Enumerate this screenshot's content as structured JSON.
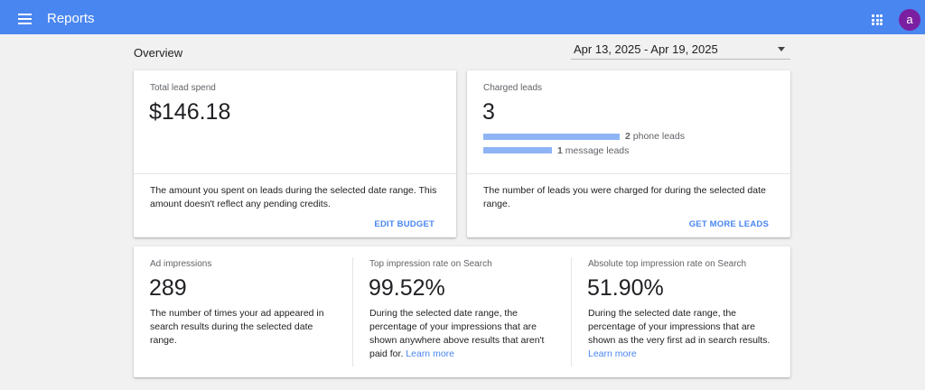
{
  "header": {
    "title": "Reports",
    "avatar_letter": "a",
    "menu_icon": "hamburger-menu-icon",
    "apps_icon": "apps-grid-icon",
    "brand_color": "#4a86f0",
    "avatar_color": "#7b1fa2"
  },
  "page": {
    "title": "Overview",
    "date_range": "Apr 13, 2025 - Apr 19, 2025"
  },
  "spend_card": {
    "label": "Total lead spend",
    "value": "$146.18",
    "description": "The amount you spent on leads during the selected date range. This amount doesn't reflect any pending credits.",
    "action": "EDIT BUDGET"
  },
  "leads_card": {
    "label": "Charged leads",
    "value": "3",
    "breakdown": [
      {
        "count": "2",
        "text": "phone leads",
        "share": 0.667
      },
      {
        "count": "1",
        "text": "message leads",
        "share": 0.333
      }
    ],
    "description": "The number of leads you were charged for during the selected date range.",
    "action": "GET MORE LEADS"
  },
  "metrics": [
    {
      "label": "Ad impressions",
      "value": "289",
      "description": "The number of times your ad appeared in search results during the selected date range.",
      "link": ""
    },
    {
      "label": "Top impression rate on Search",
      "value": "99.52%",
      "description": "During the selected date range, the percentage of your impressions that are shown anywhere above results that aren't paid for.",
      "link": "Learn more"
    },
    {
      "label": "Absolute top impression rate on Search",
      "value": "51.90%",
      "description": "During the selected date range, the percentage of your impressions that are shown as the very first ad in search results.",
      "link": "Learn more"
    }
  ]
}
